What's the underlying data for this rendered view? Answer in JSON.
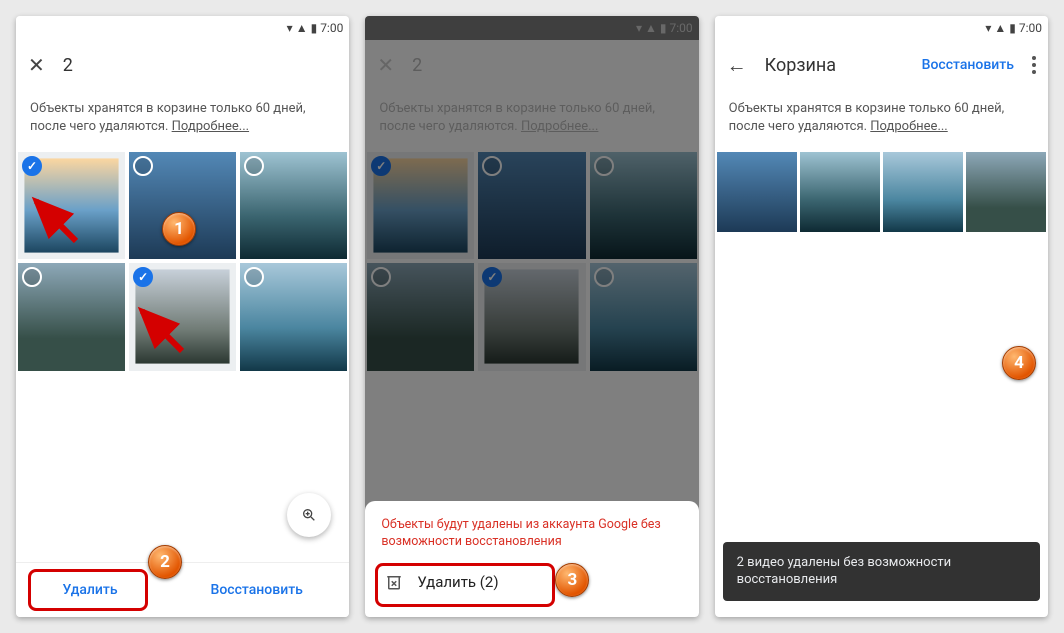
{
  "status": {
    "time": "7:00"
  },
  "screen1": {
    "count": "2",
    "info_line1": "Объекты хранятся в корзине только 60 дней,",
    "info_line2": "после чего удаляются.",
    "info_more": "Подробнее...",
    "delete": "Удалить",
    "restore": "Восстановить"
  },
  "screen2": {
    "count": "2",
    "info_line1": "Объекты хранятся в корзине только 60 дней,",
    "info_line2": "после чего удаляются.",
    "info_more": "Подробнее...",
    "warn": "Объекты будут удалены из аккаунта Google без возможности восстановления",
    "delete_count": "Удалить (2)"
  },
  "screen3": {
    "title": "Корзина",
    "restore": "Восстановить",
    "info_line1": "Объекты хранятся в корзине только 60 дней,",
    "info_line2": "после чего удаляются.",
    "info_more": "Подробнее...",
    "snackbar": "2 видео удалены без возможности восстановления"
  },
  "badges": {
    "b1": "1",
    "b2": "2",
    "b3": "3",
    "b4": "4"
  }
}
